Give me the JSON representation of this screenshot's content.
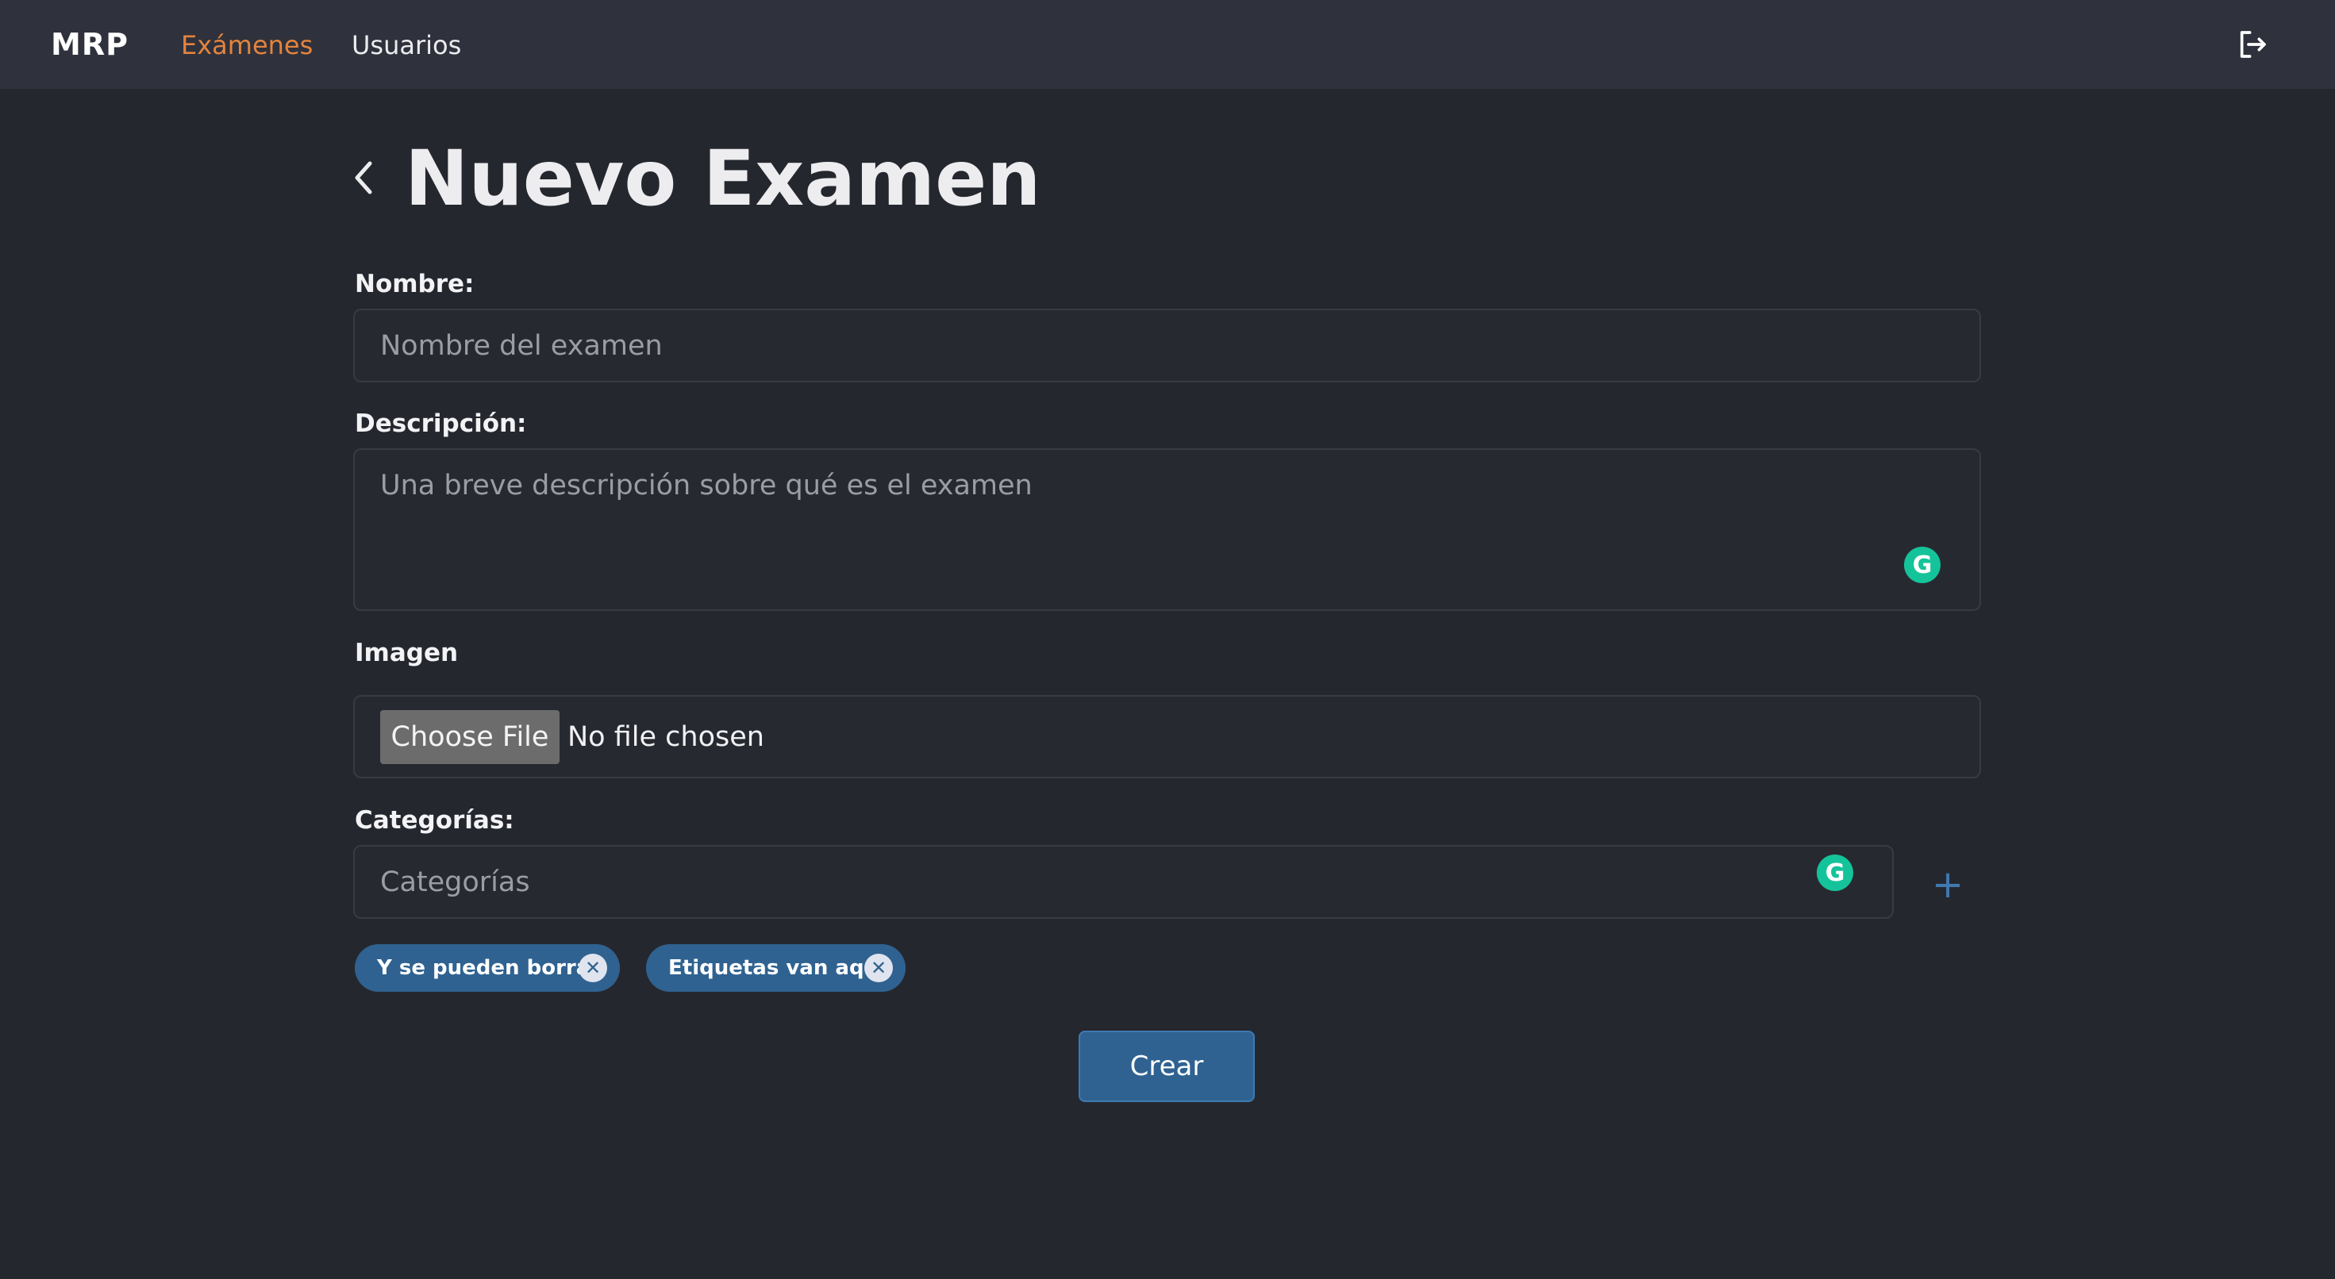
{
  "nav": {
    "brand": "MRP",
    "links": [
      {
        "label": "Exámenes",
        "active": true
      },
      {
        "label": "Usuarios",
        "active": false
      }
    ],
    "logout_icon": "logout-icon",
    "active_color": "#e3843d"
  },
  "page": {
    "title": "Nuevo Examen",
    "back_icon": "chevron-left-icon"
  },
  "form": {
    "nombre": {
      "label": "Nombre:",
      "placeholder": "Nombre del examen",
      "value": ""
    },
    "descripcion": {
      "label": "Descripción:",
      "placeholder": "Una breve descripción sobre qué es el examen",
      "value": ""
    },
    "imagen": {
      "label": "Imagen",
      "button_label": "Choose File",
      "status": "No file chosen"
    },
    "categorias": {
      "label": "Categorías:",
      "placeholder": "Categorías",
      "add_label": "+",
      "tags": [
        {
          "label": "Y se pueden borrar",
          "remove_label": "✕"
        },
        {
          "label": "Etiquetas van aquí",
          "remove_label": "✕"
        }
      ]
    },
    "submit_label": "Crear"
  },
  "extensions": {
    "grammarly_glyph": "G",
    "grammarly_color": "#15c39a"
  },
  "colors": {
    "background": "#25272f",
    "topbar": "#2f313c",
    "tag": "#2f6290"
  }
}
